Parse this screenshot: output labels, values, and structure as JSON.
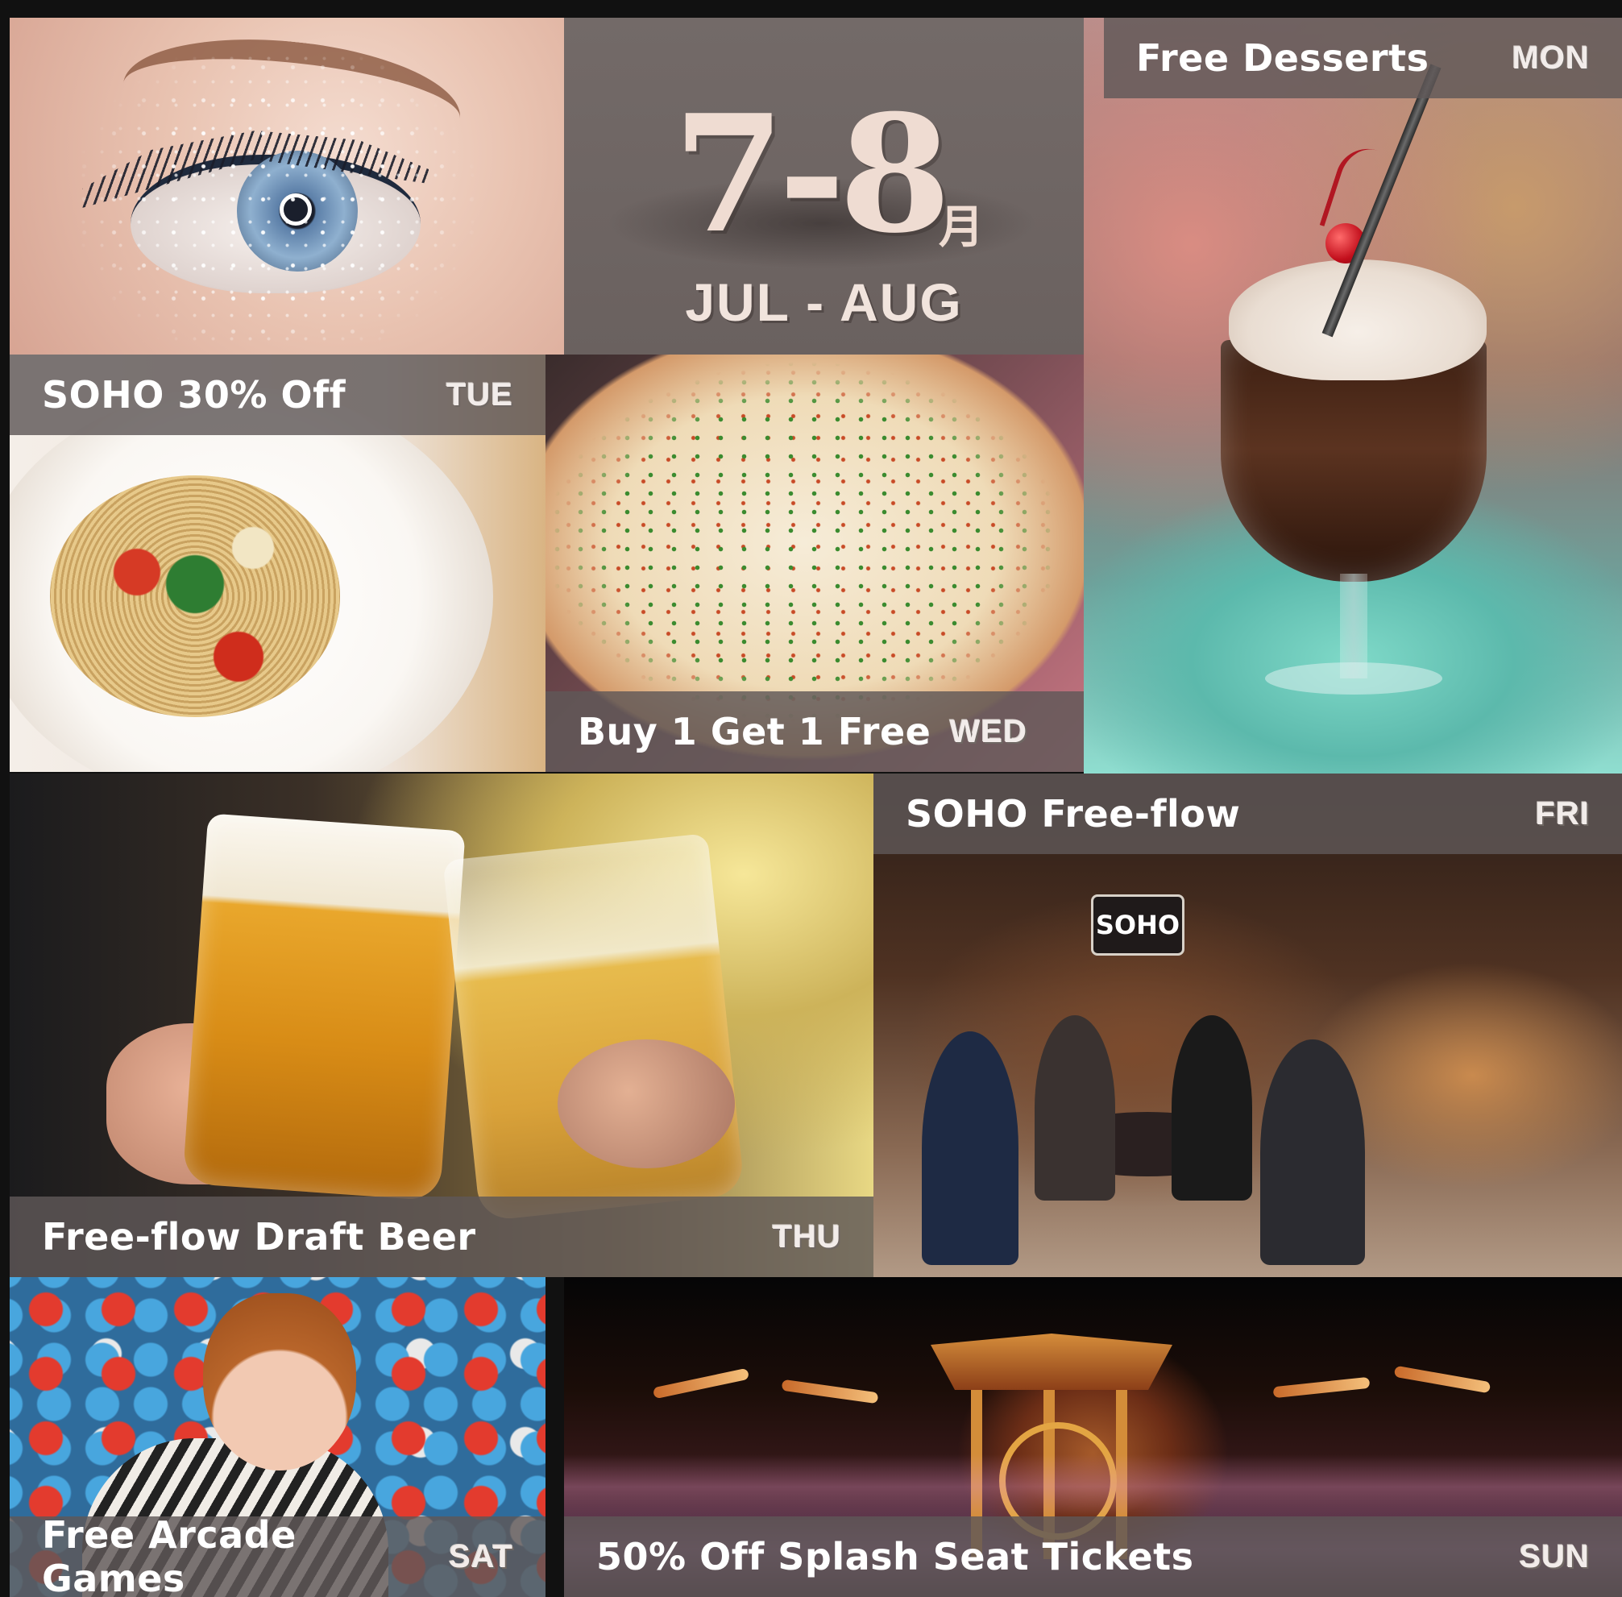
{
  "header": {
    "date_numbers": "7-8",
    "date_month_cn": "月",
    "date_en": "JUL - AUG"
  },
  "promos": [
    {
      "title": "Free Desserts",
      "day": "MON"
    },
    {
      "title": "SOHO 30% Off",
      "day": "TUE"
    },
    {
      "title": "Buy 1 Get 1 Free",
      "day": "WED"
    },
    {
      "title": "Free-flow Draft Beer",
      "day": "THU"
    },
    {
      "title": "SOHO Free-flow",
      "day": "FRI"
    },
    {
      "title": "Free Arcade Games",
      "day": "SAT"
    },
    {
      "title": "50% Off Splash Seat Tickets",
      "day": "SUN"
    }
  ],
  "signage": {
    "soho_sign": "SOHO"
  },
  "colors": {
    "caption_bar": "#5f5858",
    "date_panel": "#6d6462",
    "text": "#ffffff"
  }
}
